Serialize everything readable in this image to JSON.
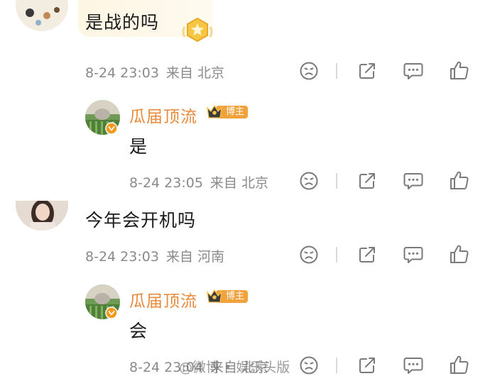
{
  "comments": [
    {
      "text": "是战的吗",
      "time": "8-24 23:03",
      "location": "来自 北京"
    },
    {
      "text": "今年会开机吗",
      "time": "8-24 23:03",
      "location": "来自 河南"
    }
  ],
  "replies": [
    {
      "username": "瓜届顶流",
      "badge": "博主",
      "text": "是",
      "time": "8-24 23:05",
      "location": "来自 北京"
    },
    {
      "username": "瓜届顶流",
      "badge": "博主",
      "text": "会",
      "time": "8-24 23:04",
      "location": "来自 北京"
    }
  ],
  "watermark": "@微博 • 娱乐头版",
  "colors": {
    "username": "#e9893a",
    "meta": "#8a8a8a",
    "badge": "#f2a23a",
    "icon": "#7a7a7a"
  },
  "icons": [
    "dislike-icon",
    "share-icon",
    "comment-icon",
    "like-icon",
    "crown-icon",
    "verified-icon",
    "gold-badge-icon"
  ]
}
